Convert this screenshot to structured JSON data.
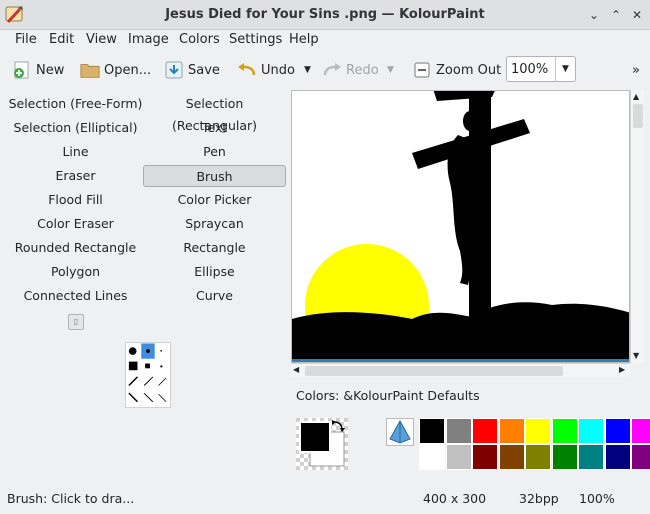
{
  "window": {
    "title": "Jesus Died for Your Sins .png  — KolourPaint"
  },
  "menubar": [
    "File",
    "Edit",
    "View",
    "Image",
    "Colors",
    "Settings",
    "Help"
  ],
  "toolbar": {
    "new_label": "New",
    "open_label": "Open...",
    "save_label": "Save",
    "undo_label": "Undo",
    "redo_label": "Redo",
    "zoom_out_label": "Zoom Out",
    "zoom_value": "100%",
    "overflow": "»"
  },
  "tools": [
    "Selection (Free-Form)",
    "Selection (Rectangular)",
    "Selection (Elliptical)",
    "Text",
    "Line",
    "Pen",
    "Eraser",
    "Brush",
    "Flood Fill",
    "Color Picker",
    "Color Eraser",
    "Spraycan",
    "Rounded Rectangle",
    "Rectangle",
    "Polygon",
    "Ellipse",
    "Connected Lines",
    "Curve"
  ],
  "active_tool": "Brush",
  "colors": {
    "label": "Colors: &KolourPaint Defaults",
    "foreground": "#000000",
    "background": "#ffffff",
    "palette_top": [
      "#000000",
      "#808080",
      "#ff0000",
      "#ff8000",
      "#ffff00",
      "#00ff00",
      "#00ffff",
      "#0000ff",
      "#ff00ff"
    ],
    "palette_bottom": [
      "#ffffff",
      "#c0c0c0",
      "#800000",
      "#804000",
      "#808000",
      "#008000",
      "#008080",
      "#000080",
      "#800080"
    ]
  },
  "status": {
    "message": "Brush: Click to dra...",
    "dimensions": "400 x 300",
    "depth": "32bpp",
    "zoom": "100%"
  }
}
